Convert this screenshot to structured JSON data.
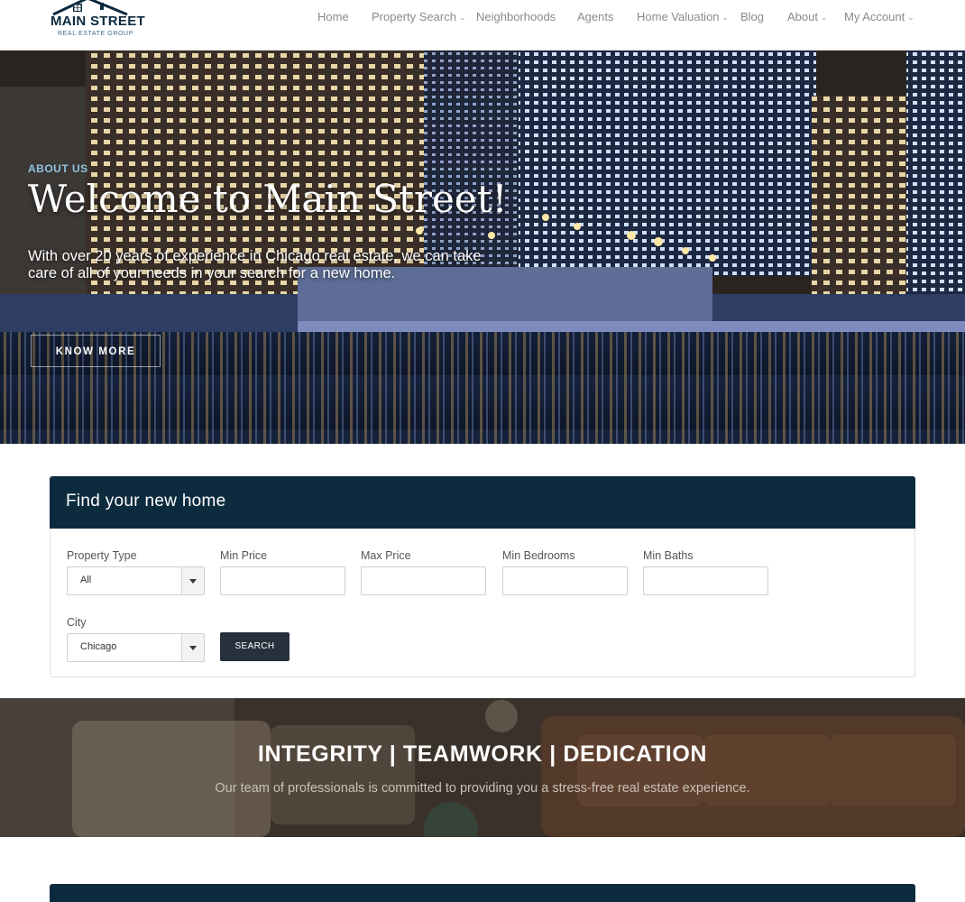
{
  "brand": {
    "name": "MAIN STREET",
    "tagline": "REAL ESTATE GROUP",
    "logo_icon": "house-roof-icon"
  },
  "nav": [
    {
      "label": "Home",
      "has_dropdown": false
    },
    {
      "label": "Property Search",
      "has_dropdown": true
    },
    {
      "label": "Neighborhoods",
      "has_dropdown": false
    },
    {
      "label": "Agents",
      "has_dropdown": false
    },
    {
      "label": "Home Valuation",
      "has_dropdown": true
    },
    {
      "label": "Blog",
      "has_dropdown": false
    },
    {
      "label": "About",
      "has_dropdown": true
    },
    {
      "label": "My Account",
      "has_dropdown": true
    }
  ],
  "hero": {
    "eyebrow": "ABOUT US",
    "title": "Welcome to Main Street!",
    "description": "With over 20 years of experience in Chicago real estate, we can take care of all of your needs in your search for a new home.",
    "button": "KNOW MORE"
  },
  "search": {
    "title": "Find your new home",
    "fields": {
      "property_type": {
        "label": "Property Type",
        "value": "All"
      },
      "min_price": {
        "label": "Min Price",
        "value": ""
      },
      "max_price": {
        "label": "Max Price",
        "value": ""
      },
      "min_bedrooms": {
        "label": "Min Bedrooms",
        "value": ""
      },
      "min_baths": {
        "label": "Min Baths",
        "value": ""
      },
      "city": {
        "label": "City",
        "value": "Chicago"
      }
    },
    "button": "SEARCH"
  },
  "values": {
    "title": "INTEGRITY | TEAMWORK | DEDICATION",
    "subtitle": "Our team of professionals is committed to providing you a stress-free real estate experience."
  },
  "colors": {
    "navy": "#0d2b3e",
    "accent": "#8fc3de",
    "button_dark": "#27313d",
    "nav_text": "#8a8a8a"
  }
}
